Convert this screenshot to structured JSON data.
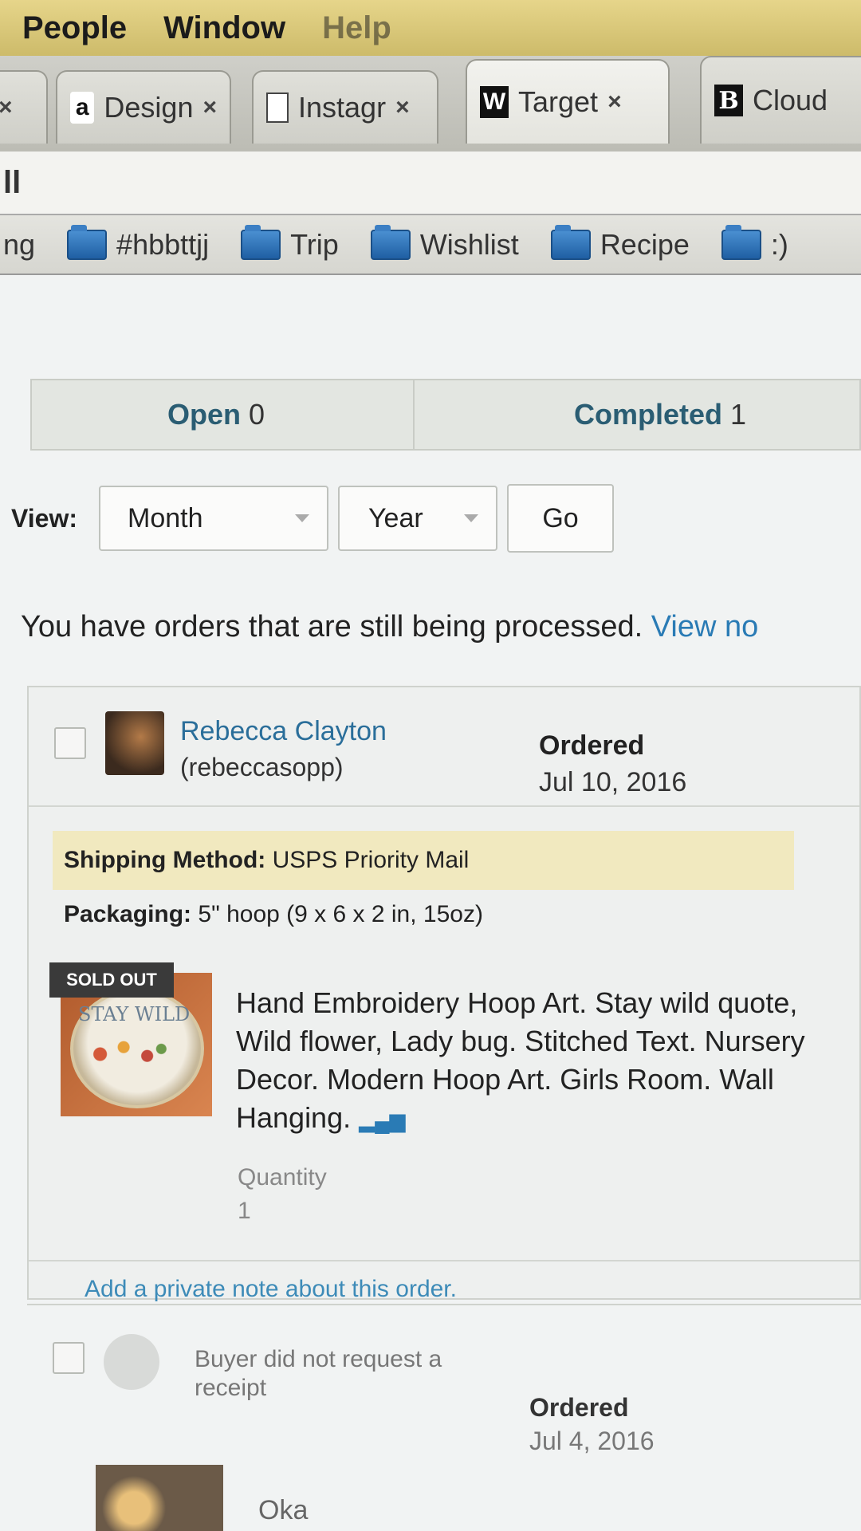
{
  "menubar": {
    "items": [
      "People",
      "Window",
      "Help"
    ]
  },
  "tabs": [
    {
      "favicon": "",
      "label": "",
      "close": "×"
    },
    {
      "favicon": "amazon-icon",
      "glyph": "a",
      "label": "Design",
      "close": "×"
    },
    {
      "favicon": "document-icon",
      "glyph": "",
      "label": "Instagr",
      "close": "×"
    },
    {
      "favicon": "w-icon",
      "glyph": "W",
      "label": "Target",
      "close": "×"
    },
    {
      "favicon": "b-icon",
      "glyph": "B",
      "label": "Cloud",
      "close": ""
    }
  ],
  "address": {
    "menu_glyph": "ll"
  },
  "bookmarks": [
    {
      "label": "ng",
      "folder": false
    },
    {
      "label": "#hbbttjj",
      "folder": true
    },
    {
      "label": "Trip",
      "folder": true
    },
    {
      "label": "Wishlist",
      "folder": true
    },
    {
      "label": "Recipe",
      "folder": true
    },
    {
      "label": ":)",
      "folder": true
    }
  ],
  "orders": {
    "open_label": "Open",
    "open_count": "0",
    "completed_label": "Completed",
    "completed_count": "1",
    "view_label": "View:",
    "month_select": "Month",
    "year_select": "Year",
    "go_button": "Go",
    "processing_message": "You have orders that are still being processed.",
    "processing_link": "View no"
  },
  "order": {
    "buyer_name": "Rebecca Clayton",
    "buyer_username": "(rebeccasopp)",
    "ordered_label": "Ordered",
    "ordered_date": "Jul 10, 2016",
    "shipping_label": "Shipping Method:",
    "shipping_value": "USPS Priority Mail",
    "packaging_label": "Packaging:",
    "packaging_value": "5\" hoop (9 x 6 x 2 in, 15oz)",
    "sold_out_badge": "SOLD OUT",
    "image_text": "STAY WILD",
    "title": "Hand Embroidery Hoop Art. Stay wild quote, Wild flower, Lady bug. Stitched Text. Nursery Decor. Modern Hoop Art. Girls Room. Wall Hanging.",
    "stats_icon": "bar-chart-icon",
    "quantity_label": "Quantity",
    "quantity_value": "1",
    "note_link": "Add a private note about this order."
  },
  "next_order": {
    "receipt_note": "Buyer did not request a receipt",
    "ordered_label": "Ordered",
    "ordered_date": "Jul 4, 2016",
    "buyer_partial": "Oka"
  }
}
